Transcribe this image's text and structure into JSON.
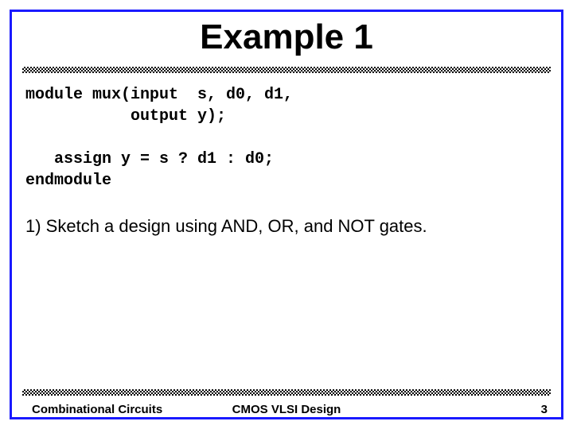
{
  "title": "Example 1",
  "code": {
    "line1": "module mux(input  s, d0, d1,",
    "line2": "           output y);",
    "line3": "",
    "line4": "   assign y = s ? d1 : d0;",
    "line5": "endmodule"
  },
  "question": "1) Sketch a design using AND, OR, and NOT gates.",
  "footer": {
    "left": "Combinational Circuits",
    "center": "CMOS VLSI Design",
    "right": "3"
  }
}
